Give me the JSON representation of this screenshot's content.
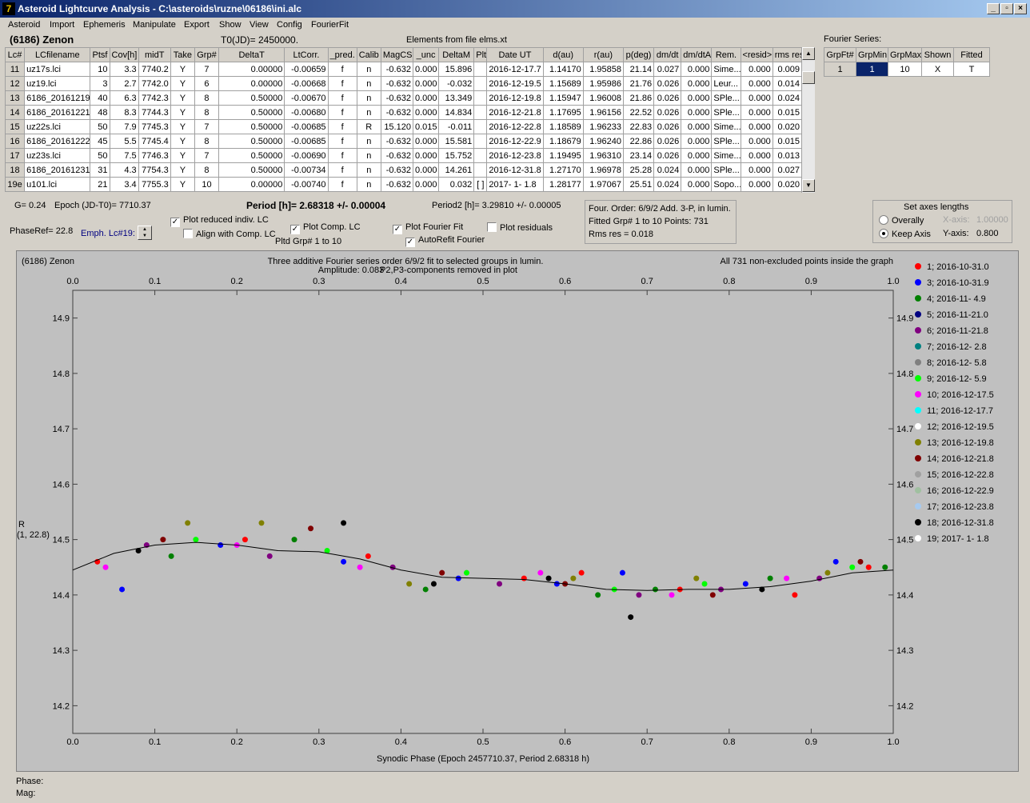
{
  "window": {
    "title": "Asteroid Lightcurve Analysis - C:\\asteroids\\ruzne\\06186\\ini.alc",
    "icon": "app-icon",
    "minimize": "_",
    "restore": "▫",
    "close": "×"
  },
  "menu": [
    "Asteroid",
    "Import",
    "Ephemeris",
    "Manipulate",
    "Export",
    "Show",
    "View",
    "Config",
    "FourierFit"
  ],
  "header": {
    "asteroid": "(6186) Zenon",
    "t0": "T0(JD)= 2450000.",
    "elements": "Elements from file elms.xt"
  },
  "lc_table": {
    "columns": [
      "Lc#",
      "LCfilename",
      "Ptsf",
      "Cov[h]",
      "midT",
      "Take",
      "Grp#",
      "DeltaT",
      "LtCorr.",
      "_pred.",
      "Calib",
      "MagCS",
      "_unc",
      "DeltaM",
      "Plt",
      "Date UT",
      "d(au)",
      "r(au)",
      "p(deg)",
      "dm/dt",
      "dm/dtA",
      "Rem.",
      "<resid>",
      "rms res"
    ],
    "rows": [
      [
        "11",
        "uz17s.lci",
        "10",
        "3.3",
        "7740.2",
        "Y",
        "7",
        "0.00000",
        "-0.00659",
        "f",
        "n",
        "-0.632",
        "0.000",
        "15.896",
        "",
        "2016-12-17.7",
        "1.14170",
        "1.95858",
        "21.14",
        "0.027",
        "0.000",
        "Sime...",
        "0.000",
        "0.009"
      ],
      [
        "12",
        "uz19.lci",
        "3",
        "2.7",
        "7742.0",
        "Y",
        "6",
        "0.00000",
        "-0.00668",
        "f",
        "n",
        "-0.632",
        "0.000",
        "-0.032",
        "",
        "2016-12-19.5",
        "1.15689",
        "1.95986",
        "21.76",
        "0.026",
        "0.000",
        "Leur...",
        "0.000",
        "0.014"
      ],
      [
        "13",
        "6186_20161219",
        "40",
        "6.3",
        "7742.3",
        "Y",
        "8",
        "0.50000",
        "-0.00670",
        "f",
        "n",
        "-0.632",
        "0.000",
        "13.349",
        "",
        "2016-12-19.8",
        "1.15947",
        "1.96008",
        "21.86",
        "0.026",
        "0.000",
        "SPle...",
        "0.000",
        "0.024"
      ],
      [
        "14",
        "6186_20161221",
        "48",
        "8.3",
        "7744.3",
        "Y",
        "8",
        "0.50000",
        "-0.00680",
        "f",
        "n",
        "-0.632",
        "0.000",
        "14.834",
        "",
        "2016-12-21.8",
        "1.17695",
        "1.96156",
        "22.52",
        "0.026",
        "0.000",
        "SPle...",
        "0.000",
        "0.015"
      ],
      [
        "15",
        "uz22s.lci",
        "50",
        "7.9",
        "7745.3",
        "Y",
        "7",
        "0.50000",
        "-0.00685",
        "f",
        "R",
        "15.120",
        "0.015",
        "-0.011",
        "",
        "2016-12-22.8",
        "1.18589",
        "1.96233",
        "22.83",
        "0.026",
        "0.000",
        "Sime...",
        "0.000",
        "0.020"
      ],
      [
        "16",
        "6186_20161222",
        "45",
        "5.5",
        "7745.4",
        "Y",
        "8",
        "0.50000",
        "-0.00685",
        "f",
        "n",
        "-0.632",
        "0.000",
        "15.581",
        "",
        "2016-12-22.9",
        "1.18679",
        "1.96240",
        "22.86",
        "0.026",
        "0.000",
        "SPle...",
        "0.000",
        "0.015"
      ],
      [
        "17",
        "uz23s.lci",
        "50",
        "7.5",
        "7746.3",
        "Y",
        "7",
        "0.50000",
        "-0.00690",
        "f",
        "n",
        "-0.632",
        "0.000",
        "15.752",
        "",
        "2016-12-23.8",
        "1.19495",
        "1.96310",
        "23.14",
        "0.026",
        "0.000",
        "Sime...",
        "0.000",
        "0.013"
      ],
      [
        "18",
        "6186_20161231",
        "31",
        "4.3",
        "7754.3",
        "Y",
        "8",
        "0.50000",
        "-0.00734",
        "f",
        "n",
        "-0.632",
        "0.000",
        "14.261",
        "",
        "2016-12-31.8",
        "1.27170",
        "1.96978",
        "25.28",
        "0.024",
        "0.000",
        "SPle...",
        "0.000",
        "0.027"
      ],
      [
        "19e",
        "u101.lci",
        "21",
        "3.4",
        "7755.3",
        "Y",
        "10",
        "0.00000",
        "-0.00740",
        "f",
        "n",
        "-0.632",
        "0.000",
        "0.032",
        "[ ]",
        "2017- 1- 1.8",
        "1.28177",
        "1.97067",
        "25.51",
        "0.024",
        "0.000",
        "Sopo...",
        "0.000",
        "0.020"
      ]
    ]
  },
  "fourier_series": {
    "label": "Fourier Series:",
    "columns": [
      "GrpFt#",
      "GrpMin",
      "GrpMax",
      "Shown",
      "Fitted"
    ],
    "row": [
      "1",
      "1",
      "10",
      "X",
      "T"
    ]
  },
  "controls": {
    "g": "G= 0.24",
    "epoch": "Epoch (JD-T0)= 7710.37",
    "period": "Period [h]= 2.68318 +/- 0.00004",
    "period2": "Period2 [h]= 3.29810 +/- 0.00005",
    "phaseref": "PhaseRef= 22.8",
    "emph": "Emph. Lc#19:",
    "plot_reduced": "Plot reduced indiv. LC",
    "align_comp": "Align with Comp. LC",
    "plot_comp": "Plot Comp. LC",
    "pltd_grp": "Pltd Grp#  1   to   10",
    "plot_fourier": "Plot Fourier Fit",
    "autorefit": "AutoRefit Fourier",
    "plot_residuals": "Plot residuals",
    "check_mark": "✓"
  },
  "fit_info": {
    "line1": "Four. Order:  6/9/2   Add. 3-P, in lumin.",
    "line2": "Fitted Grp# 1 to 10   Points: 731",
    "line3": "Rms res     = 0.018"
  },
  "axes_box": {
    "title": "Set axes lengths",
    "overally": "Overally",
    "keep_axis": "Keep Axis",
    "x_axis_label": "X-axis:",
    "x_axis_value": "1.00000",
    "y_axis_label": "Y-axis:",
    "y_axis_value": "0.800"
  },
  "plot": {
    "name": "(6186) Zenon",
    "title_line1": "Three additive Fourier series order 6/9/2 fit to selected groups in lumin.",
    "title_line2": "Amplitude: 0.083",
    "title_line3": "P2,P3-components removed in plot",
    "points_note": "All 731 non-excluded points inside the graph",
    "ylabel": "R",
    "ylabel2": "(1, 22.8)",
    "xlabel": "Synodic Phase (Epoch 2457710.37, Period 2.68318 h)",
    "xticks": [
      "0.0",
      "0.1",
      "0.2",
      "0.3",
      "0.4",
      "0.5",
      "0.6",
      "0.7",
      "0.8",
      "0.9",
      "1.0"
    ],
    "yticks": [
      "14.2",
      "14.3",
      "14.4",
      "14.5",
      "14.6",
      "14.7",
      "14.8",
      "14.9"
    ]
  },
  "legend": [
    {
      "label": "1; 2016-10-31.0",
      "color": "#ff0000"
    },
    {
      "label": "3; 2016-10-31.9",
      "color": "#0000ff"
    },
    {
      "label": "4; 2016-11- 4.9",
      "color": "#008000"
    },
    {
      "label": "5; 2016-11-21.0",
      "color": "#000080"
    },
    {
      "label": "6; 2016-11-21.8",
      "color": "#800080"
    },
    {
      "label": "7; 2016-12- 2.8",
      "color": "#008080"
    },
    {
      "label": "8; 2016-12- 5.8",
      "color": "#808080"
    },
    {
      "label": "9; 2016-12- 5.9",
      "color": "#00ff00"
    },
    {
      "label": "10; 2016-12-17.5",
      "color": "#ff00ff"
    },
    {
      "label": "11; 2016-12-17.7",
      "color": "#00ffff"
    },
    {
      "label": "12; 2016-12-19.5",
      "color": "#ffffff"
    },
    {
      "label": "13; 2016-12-19.8",
      "color": "#808000"
    },
    {
      "label": "14; 2016-12-21.8",
      "color": "#800000"
    },
    {
      "label": "15; 2016-12-22.8",
      "color": "#a0a0a0"
    },
    {
      "label": "16; 2016-12-22.9",
      "color": "#a0c0a0"
    },
    {
      "label": "17; 2016-12-23.8",
      "color": "#a6caf0"
    },
    {
      "label": "18; 2016-12-31.8",
      "color": "#000000"
    },
    {
      "label": "19; 2017- 1- 1.8",
      "color": "#ffffff"
    }
  ],
  "chart_data": {
    "type": "scatter",
    "title": "Three additive Fourier series order 6/9/2 fit to selected groups in lumin.",
    "xlabel": "Synodic Phase (Epoch 2457710.37, Period 2.68318 h)",
    "ylabel": "R",
    "xlim": [
      0.0,
      1.0
    ],
    "ylim": [
      14.95,
      14.15
    ],
    "y_inverted": true,
    "legend_position": "right",
    "grid": false,
    "fit_curve": {
      "x": [
        0.0,
        0.05,
        0.1,
        0.15,
        0.2,
        0.25,
        0.3,
        0.35,
        0.4,
        0.45,
        0.5,
        0.55,
        0.6,
        0.65,
        0.7,
        0.75,
        0.8,
        0.85,
        0.9,
        0.95,
        1.0
      ],
      "y": [
        14.445,
        14.475,
        14.49,
        14.495,
        14.49,
        14.48,
        14.478,
        14.465,
        14.445,
        14.432,
        14.43,
        14.428,
        14.42,
        14.41,
        14.408,
        14.41,
        14.41,
        14.415,
        14.425,
        14.44,
        14.445
      ]
    },
    "series": [
      {
        "name": "1; 2016-10-31.0",
        "x": [
          0.03,
          0.21,
          0.36,
          0.55,
          0.62,
          0.74,
          0.88,
          0.97
        ],
        "y": [
          14.46,
          14.5,
          14.47,
          14.43,
          14.44,
          14.41,
          14.4,
          14.45
        ]
      },
      {
        "name": "3; 2016-10-31.9",
        "x": [
          0.06,
          0.18,
          0.33,
          0.47,
          0.59,
          0.67,
          0.82,
          0.93
        ],
        "y": [
          14.41,
          14.49,
          14.46,
          14.43,
          14.42,
          14.44,
          14.42,
          14.46
        ]
      },
      {
        "name": "4; 2016-11- 4.9",
        "x": [
          0.12,
          0.27,
          0.43,
          0.64,
          0.71,
          0.85,
          0.99
        ],
        "y": [
          14.47,
          14.5,
          14.41,
          14.4,
          14.41,
          14.43,
          14.45
        ]
      },
      {
        "name": "6; 2016-11-21.8",
        "x": [
          0.09,
          0.24,
          0.39,
          0.52,
          0.69,
          0.79,
          0.91
        ],
        "y": [
          14.49,
          14.47,
          14.45,
          14.42,
          14.4,
          14.41,
          14.43
        ]
      },
      {
        "name": "9; 2016-12- 5.9",
        "x": [
          0.15,
          0.31,
          0.48,
          0.66,
          0.77,
          0.95
        ],
        "y": [
          14.5,
          14.48,
          14.44,
          14.41,
          14.42,
          14.45
        ]
      },
      {
        "name": "10; 2016-12-17.5",
        "x": [
          0.04,
          0.2,
          0.35,
          0.57,
          0.73,
          0.87
        ],
        "y": [
          14.45,
          14.49,
          14.45,
          14.44,
          14.4,
          14.43
        ]
      },
      {
        "name": "13; 2016-12-19.8",
        "x": [
          0.14,
          0.23,
          0.41,
          0.61,
          0.76,
          0.92
        ],
        "y": [
          14.53,
          14.53,
          14.42,
          14.43,
          14.43,
          14.44
        ]
      },
      {
        "name": "14; 2016-12-21.8",
        "x": [
          0.11,
          0.29,
          0.45,
          0.6,
          0.78,
          0.96
        ],
        "y": [
          14.5,
          14.52,
          14.44,
          14.42,
          14.4,
          14.46
        ]
      },
      {
        "name": "18; 2016-12-31.8",
        "x": [
          0.08,
          0.33,
          0.44,
          0.58,
          0.68,
          0.84
        ],
        "y": [
          14.48,
          14.53,
          14.42,
          14.43,
          14.36,
          14.41
        ]
      }
    ]
  }
}
